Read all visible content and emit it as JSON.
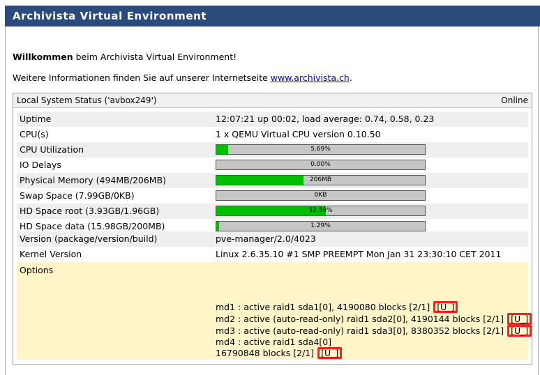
{
  "header": {
    "title": "Archivista Virtual Environment"
  },
  "welcome": {
    "bold": "Willkommen",
    "rest": " beim Archivista Virtual Environment!"
  },
  "info": {
    "prefix": "Weitere Informationen finden Sie auf unserer Internetseite ",
    "link": "www.archivista.ch",
    "suffix": "."
  },
  "panel": {
    "title": "Local System Status ('avbox249')",
    "status": "Online",
    "rows": {
      "uptime": {
        "label": "Uptime",
        "value": "12:07:21 up 00:02, load average: 0.74, 0.58, 0.23"
      },
      "cpus": {
        "label": "CPU(s)",
        "value": "1 x QEMU Virtual CPU version 0.10.50"
      },
      "cpu_util": {
        "label": "CPU Utilization",
        "bar_text": "5.69%",
        "percent": 5.69
      },
      "io_delays": {
        "label": "IO Delays",
        "bar_text": "0.00%",
        "percent": 0
      },
      "phys_mem": {
        "label": "Physical Memory (494MB/206MB)",
        "bar_text": "206MB",
        "percent": 41.7
      },
      "swap": {
        "label": "Swap Space (7.99GB/0KB)",
        "bar_text": "0KB",
        "percent": 0
      },
      "hd_root": {
        "label": "HD Space root (3.93GB/1.96GB)",
        "bar_text": "52.59%",
        "percent": 52.59
      },
      "hd_data": {
        "label": "HD Space data (15.98GB/200MB)",
        "bar_text": "1.29%",
        "percent": 1.29
      },
      "version": {
        "label": "Version (package/version/build)",
        "value": "pve-manager/2.0/4023"
      },
      "kernel": {
        "label": "Kernel Version",
        "value": "Linux 2.6.35.10 #1 SMP PREEMPT Mon Jan 31 23:30:10 CET 2011"
      }
    },
    "options": {
      "label": "Options",
      "lines": [
        {
          "text": "md1 : active raid1 sda1[0], 4190080 blocks [2/1] ",
          "status": "[U_]"
        },
        {
          "text": "md2 : active (auto-read-only) raid1 sda2[0], 4190144 blocks [2/1] ",
          "status": "[U_]"
        },
        {
          "text": "md3 : active (auto-read-only) raid1 sda3[0], 8380352 blocks [2/1] ",
          "status": "[U_]"
        },
        {
          "text": "md4 : active raid1 sda4[0]",
          "status": ""
        },
        {
          "text": "16790848 blocks [2/1] ",
          "status": "[U_]"
        }
      ]
    }
  },
  "colors": {
    "header_bg": "#2a4b7c",
    "bar_fill": "#00bf00",
    "bar_bg": "#c6c6c6",
    "options_bg": "#fff5c8",
    "highlight": "#ff1f1f"
  }
}
